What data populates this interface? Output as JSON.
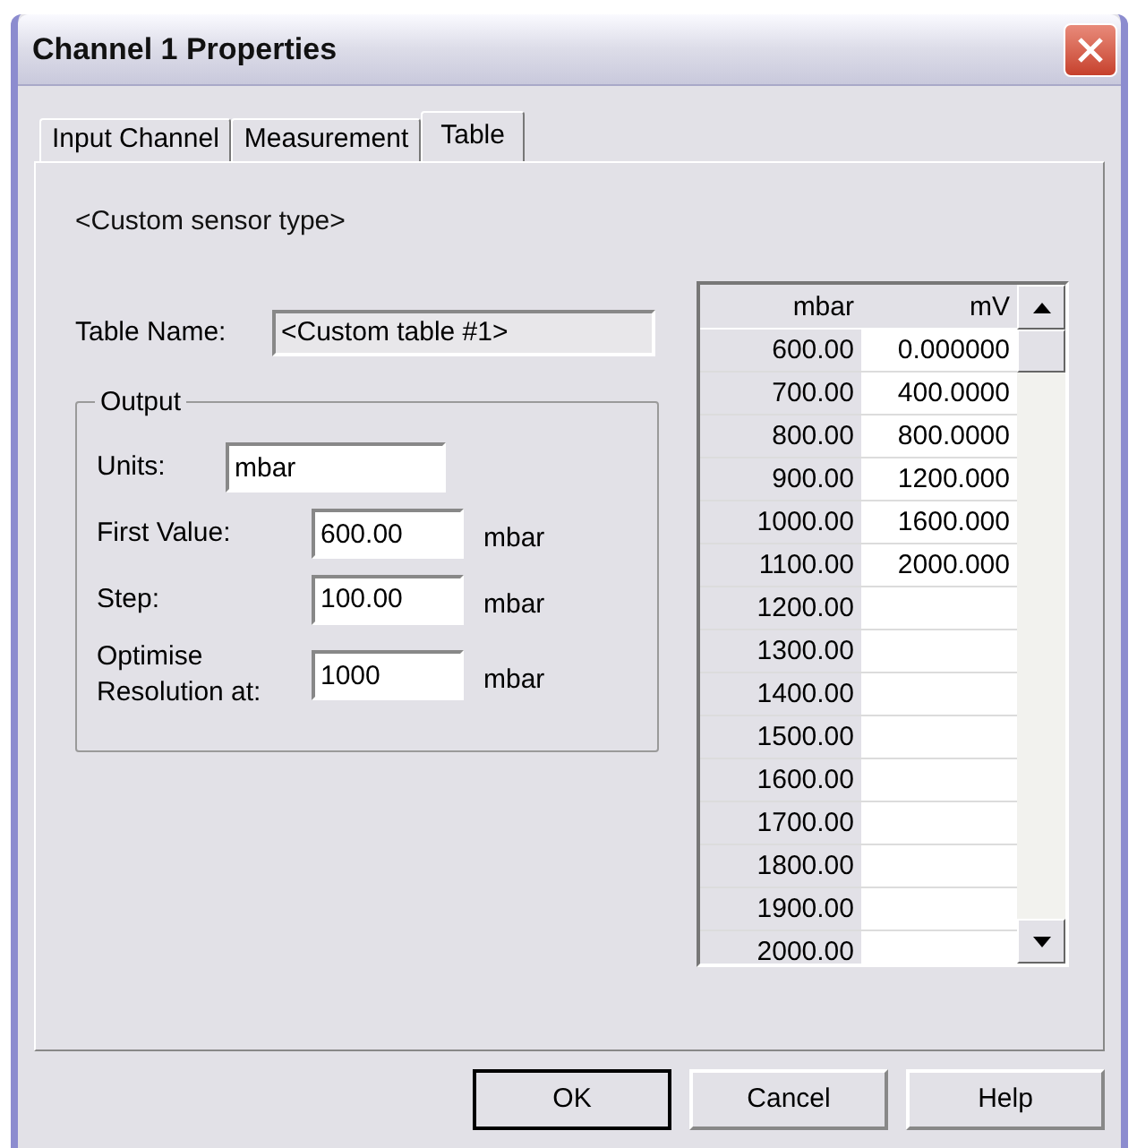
{
  "window": {
    "title": "Channel 1 Properties"
  },
  "tabs": [
    {
      "label": "Input Channel",
      "selected": false
    },
    {
      "label": "Measurement",
      "selected": false
    },
    {
      "label": "Table",
      "selected": true
    }
  ],
  "sensor_type": "<Custom sensor type>",
  "table_name": {
    "label": "Table Name:",
    "value": "<Custom table #1>",
    "read_only": true
  },
  "output": {
    "title": "Output",
    "units": {
      "label": "Units:",
      "value": "mbar"
    },
    "fields": [
      {
        "label": "First Value:",
        "value": "600.00",
        "unit": "mbar"
      },
      {
        "label": "Step:",
        "value": "100.00",
        "unit": "mbar"
      },
      {
        "label": "Optimise Resolution at:",
        "value": "1000",
        "unit": "mbar"
      }
    ]
  },
  "table": {
    "columns": [
      "mbar",
      "mV"
    ],
    "rows": [
      [
        "600.00",
        "0.000000"
      ],
      [
        "700.00",
        "400.0000"
      ],
      [
        "800.00",
        "800.0000"
      ],
      [
        "900.00",
        "1200.000"
      ],
      [
        "1000.00",
        "1600.000"
      ],
      [
        "1100.00",
        "2000.000"
      ],
      [
        "1200.00",
        ""
      ],
      [
        "1300.00",
        ""
      ],
      [
        "1400.00",
        ""
      ],
      [
        "1500.00",
        ""
      ],
      [
        "1600.00",
        ""
      ],
      [
        "1700.00",
        ""
      ],
      [
        "1800.00",
        ""
      ],
      [
        "1900.00",
        ""
      ],
      [
        "2000.00",
        ""
      ]
    ]
  },
  "buttons": [
    {
      "label": "OK",
      "default": true
    },
    {
      "label": "Cancel",
      "default": false
    },
    {
      "label": "Help",
      "default": false
    }
  ]
}
